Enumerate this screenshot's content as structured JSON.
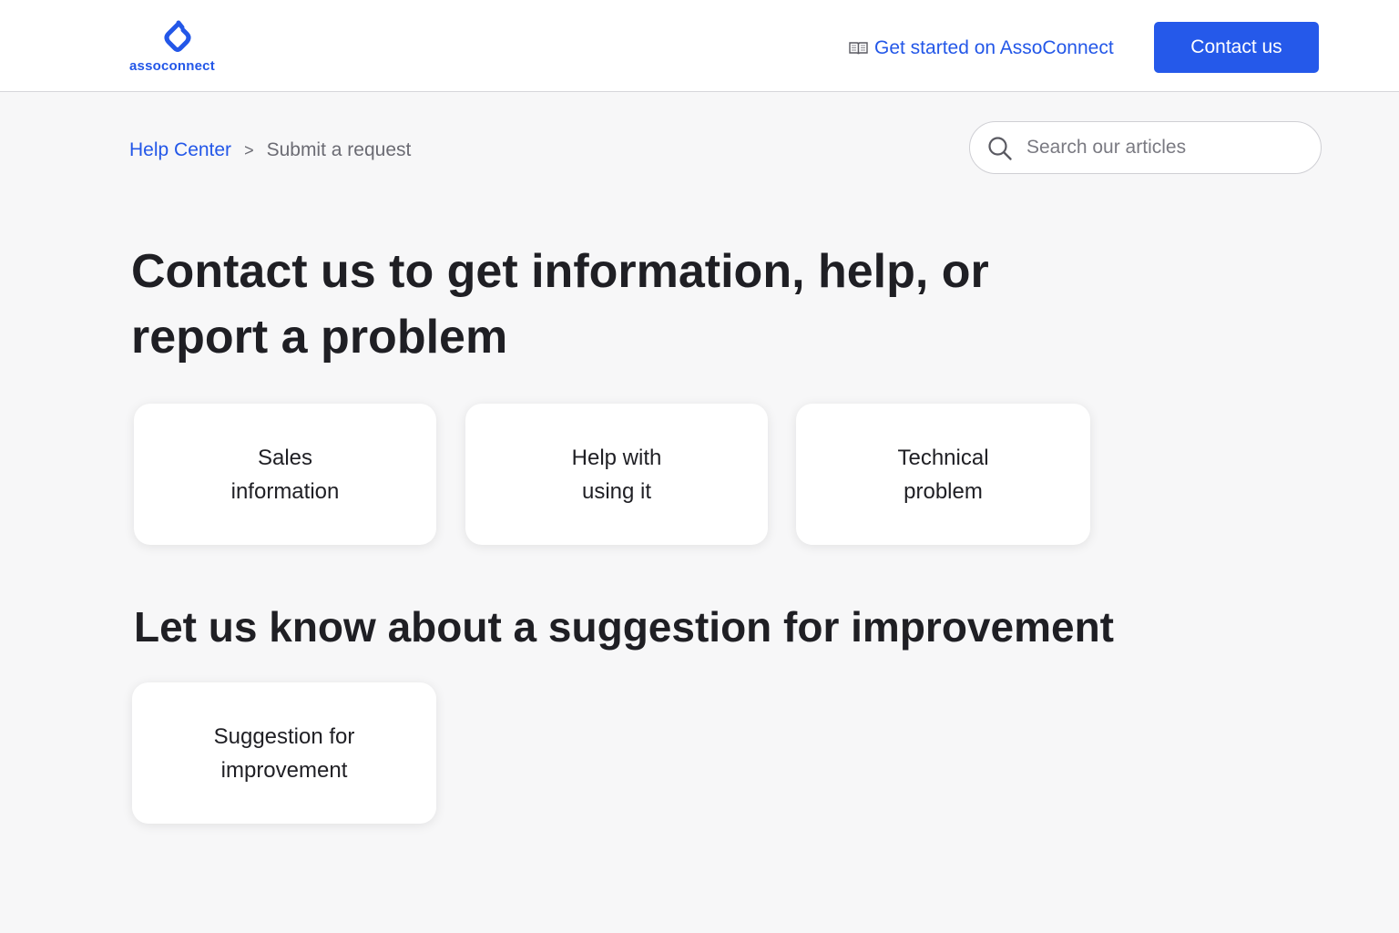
{
  "header": {
    "logo_text": "assoconnect",
    "get_started_label": "Get started on AssoConnect",
    "contact_label": "Contact us"
  },
  "breadcrumb": {
    "home": "Help Center",
    "separator": ">",
    "current": "Submit a request"
  },
  "search": {
    "placeholder": "Search our articles"
  },
  "main": {
    "title": "Contact us to get information, help, or report a problem",
    "request_cards": [
      {
        "label": "Sales\ninformation"
      },
      {
        "label": "Help with\nusing it"
      },
      {
        "label": "Technical\nproblem"
      }
    ],
    "suggestion_title": "Let us know about a suggestion for improvement",
    "suggestion_card": {
      "label": "Suggestion for\nimprovement"
    }
  },
  "colors": {
    "brand_blue": "#2559ea",
    "text_dark": "#1f1f24",
    "text_muted": "#6b6b73",
    "page_background": "#f7f7f8"
  },
  "icons": {
    "logo": "assoconnect-logo-icon",
    "book": "book-icon",
    "search": "search-icon"
  }
}
